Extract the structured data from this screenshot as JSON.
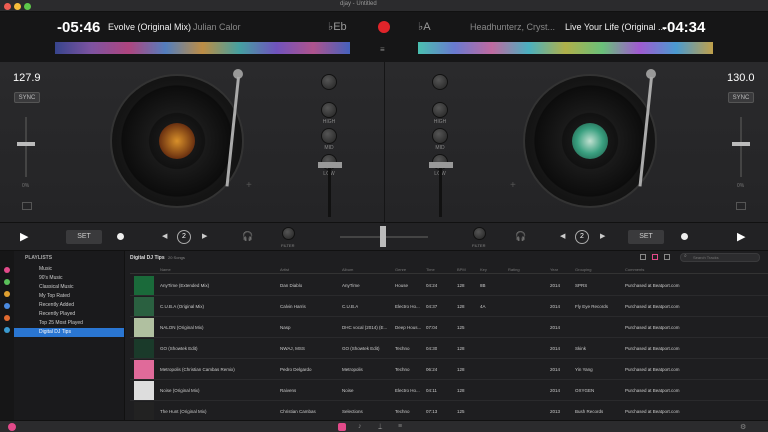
{
  "window": {
    "title": "djay - Untitled"
  },
  "deck_left": {
    "time": "-05:46",
    "title": "Evolve (Original Mix)",
    "artist": "Julian Calor",
    "key": "Eb",
    "bpm": "127.9",
    "sync": "SYNC",
    "pitch": "0%",
    "set": "SET",
    "loop": "2",
    "filter": "FILTER"
  },
  "deck_right": {
    "time": "-04:34",
    "title": "Live Your Life (Original ...",
    "artist": "Headhunterz, Cryst...",
    "key": "A",
    "bpm": "130.0",
    "sync": "SYNC",
    "pitch": "0%",
    "set": "SET",
    "loop": "2",
    "filter": "FILTER"
  },
  "mixer": {
    "high": "HIGH",
    "mid": "MID",
    "low": "LOW"
  },
  "sidebar": {
    "header": "PLAYLISTS",
    "items": [
      "Music",
      "90's Music",
      "Classical Music",
      "My Top Rated",
      "Recently Added",
      "Recently Played",
      "Top 25 Most Played",
      "Digital DJ Tips"
    ]
  },
  "library": {
    "playlist": "Digital DJ Tips",
    "count": "20 Songs",
    "search_placeholder": "Search Tracks",
    "columns": [
      "Name",
      "Artist",
      "Album",
      "Genre",
      "Time",
      "BPM",
      "Key",
      "Rating",
      "Year",
      "Grouping",
      "Comments"
    ],
    "rows": [
      [
        "AnyTime (Extended Mix)",
        "Dan Diablo",
        "AnyTime",
        "House",
        "04:24",
        "128",
        "8B",
        "",
        "2014",
        "SPRS",
        "Purchased at Beatport.com"
      ],
      [
        "C.U.B.A (Original Mix)",
        "Calvin Harris",
        "C.U.B.A",
        "Electro Ho...",
        "04:37",
        "128",
        "4A",
        "",
        "2014",
        "Fly Eye Records",
        "Purchased at Beatport.com"
      ],
      [
        "NALON (Original Mix)",
        "Nasp",
        "DHC vocal (2014) (E...",
        "Deep Hous...",
        "07:04",
        "125",
        "",
        "",
        "2014",
        "",
        "Purchased at Beatport.com"
      ],
      [
        "GO (Showtek Edit)",
        "NWAJ, MSS",
        "GO (Showtek Edit)",
        "Techno",
        "04:30",
        "128",
        "",
        "",
        "2014",
        "Skink",
        "Purchased at Beatport.com"
      ],
      [
        "Metropolis (Christian Cambas Remix)",
        "Pedro Delgardo",
        "Metropolis",
        "Techno",
        "06:24",
        "128",
        "",
        "",
        "2014",
        "Yin Yang",
        "Purchased at Beatport.com"
      ],
      [
        "Noise (Original Mix)",
        "Raivens",
        "Noise",
        "Electro Ho...",
        "04:11",
        "128",
        "",
        "",
        "2014",
        "OXYGEN",
        "Purchased at Beatport.com"
      ],
      [
        "The Hunt (Original Mix)",
        "Christian Cambas",
        "Selections",
        "Techno",
        "07:13",
        "125",
        "",
        "",
        "2013",
        "Bush Records",
        "Purchased at Beatport.com"
      ]
    ]
  },
  "colors": {
    "accent": "#2a76d2",
    "record": "#e0242a"
  }
}
